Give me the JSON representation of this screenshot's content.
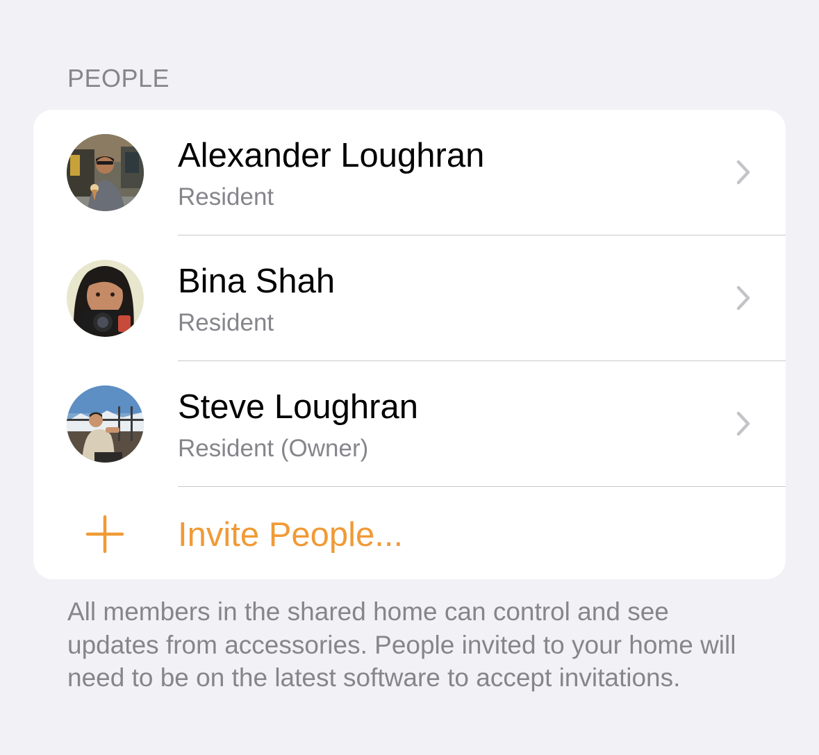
{
  "section": {
    "header": "PEOPLE"
  },
  "people": [
    {
      "name": "Alexander Loughran",
      "role": "Resident",
      "avatar_icon": "person-photo-icon",
      "chevron_icon": "chevron-right-icon"
    },
    {
      "name": "Bina Shah",
      "role": "Resident",
      "avatar_icon": "person-photo-icon",
      "chevron_icon": "chevron-right-icon"
    },
    {
      "name": "Steve Loughran",
      "role": "Resident (Owner)",
      "avatar_icon": "person-photo-icon",
      "chevron_icon": "chevron-right-icon"
    }
  ],
  "invite": {
    "label": "Invite People...",
    "icon": "plus-icon"
  },
  "footer": {
    "text": "All members in the shared home can control and see updates from accessories. People invited to your home will need to be on the latest software to accept invitations."
  },
  "colors": {
    "background": "#f2f1f6",
    "card": "#ffffff",
    "accent": "#f09a37",
    "secondary_text": "#86858b",
    "separator": "#c8c7cc",
    "chevron": "#c4c3c8"
  }
}
